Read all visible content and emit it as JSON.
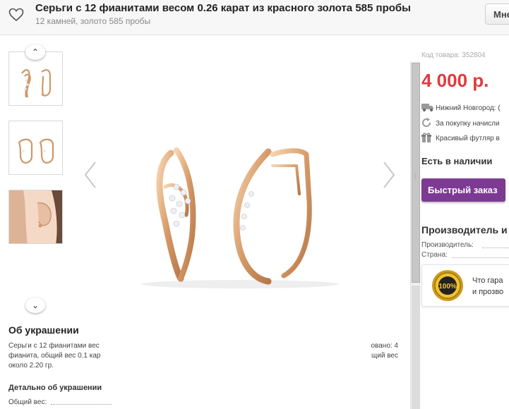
{
  "header": {
    "title": "Серьги с 12 фианитами весом 0.26 карат из красного золота 585 пробы",
    "subtitle": "12 камней, золото 585 пробы",
    "button_label": "Мне"
  },
  "gallery": {
    "thumbnails": [
      "earrings-front-side",
      "earrings-pair",
      "earring-on-ear"
    ]
  },
  "about": {
    "heading": "Об украшении",
    "text_left": [
      "Серьги с 12 фианитами вес",
      "фианита, общий вес 0.1 кар",
      "около 2.20 гр."
    ],
    "text_right": [
      "овано: 4",
      "щий вес",
      ""
    ],
    "details_heading": "Детально об украшении",
    "weight_label": "Общий вес:"
  },
  "product": {
    "code": "Код товара: 352804",
    "price": "4 000 р.",
    "info": [
      {
        "icon": "truck-icon",
        "text": "Нижний Новгород: ("
      },
      {
        "icon": "refresh-icon",
        "text": "За покупку начисли"
      },
      {
        "icon": "gift-icon",
        "text": "Красивый футляр в"
      }
    ],
    "availability": "Есть в наличии",
    "order_button": "Быстрый заказ",
    "manufacturer_heading": "Производитель и",
    "manufacturer_label": "Производитель:",
    "country_label": "Страна:",
    "guarantee_badge": "100%",
    "guarantee_lines": [
      "Что гара",
      "и прозво"
    ]
  },
  "colors": {
    "price": "#e03a3e",
    "order_button": "#7d3a93",
    "gold": "#d9a26f"
  }
}
